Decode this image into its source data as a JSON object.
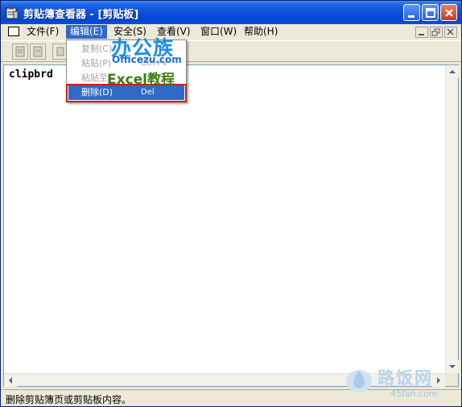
{
  "window": {
    "title": "剪贴簿查看器 - [剪贴板]",
    "controls": {
      "minimize": "minimize",
      "maximize": "maximize",
      "close": "close"
    }
  },
  "menubar": {
    "items": [
      {
        "label": "文件(F)"
      },
      {
        "label": "编辑(E)",
        "active": true
      },
      {
        "label": "安全(S)"
      },
      {
        "label": "查看(V)"
      },
      {
        "label": "窗口(W)"
      },
      {
        "label": "帮助(H)"
      }
    ]
  },
  "edit_menu": {
    "items": [
      {
        "label": "复制(C)",
        "shortcut": "",
        "enabled": false
      },
      {
        "label": "粘贴(P)",
        "shortcut": "Ctrl+V",
        "enabled": false
      },
      {
        "label": "粘贴至",
        "shortcut": "",
        "enabled": false
      },
      {
        "label": "删除(D)",
        "shortcut": "Del",
        "enabled": true,
        "selected": true
      }
    ]
  },
  "content": {
    "text": "clipbrd"
  },
  "statusbar": {
    "text": "删除剪贴簿页或剪贴板内容。"
  },
  "watermark": {
    "logo_text": "办公族",
    "url": "Officezu.com",
    "tagline": "Excel教程",
    "brand": "路饭网",
    "brand_url": "45fan.com"
  },
  "colors": {
    "titlebar": "#0a4fd8",
    "menu_highlight": "#316ac5",
    "annotation_box": "#d9141b"
  }
}
